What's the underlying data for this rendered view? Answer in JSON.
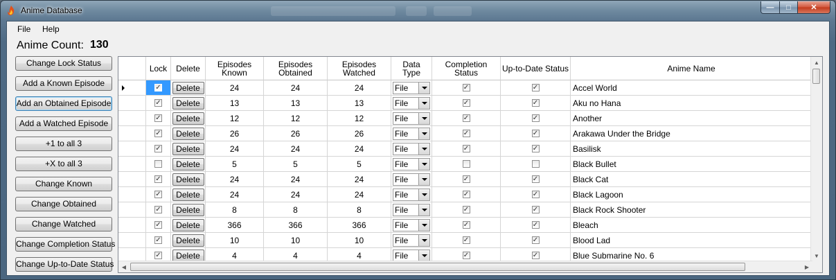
{
  "window": {
    "title": "Anime Database",
    "controls": {
      "minimize": "—",
      "maximize": "□",
      "close": "✕"
    }
  },
  "menu": [
    "File",
    "Help"
  ],
  "count": {
    "label": "Anime Count:",
    "value": "130"
  },
  "buttons": [
    "Change Lock Status",
    "Add a Known Episode",
    "Add an Obtained Episode",
    "Add a Watched Episode",
    "+1 to all 3",
    "+X to all 3",
    "Change Known",
    "Change Obtained",
    "Change Watched",
    "Change Completion Status",
    "Change Up-to-Date Status"
  ],
  "grid": {
    "columns": [
      "Lock",
      "Delete",
      "Episodes Known",
      "Episodes Obtained",
      "Episodes Watched",
      "Data Type",
      "Completion Status",
      "Up-to-Date Status",
      "Anime Name"
    ],
    "delete_label": "Delete",
    "rows": [
      {
        "lock": true,
        "known": "24",
        "obtained": "24",
        "watched": "24",
        "type": "File",
        "complete": true,
        "uptodate": true,
        "name": "Accel World"
      },
      {
        "lock": true,
        "known": "13",
        "obtained": "13",
        "watched": "13",
        "type": "File",
        "complete": true,
        "uptodate": true,
        "name": "Aku no Hana"
      },
      {
        "lock": true,
        "known": "12",
        "obtained": "12",
        "watched": "12",
        "type": "File",
        "complete": true,
        "uptodate": true,
        "name": "Another"
      },
      {
        "lock": true,
        "known": "26",
        "obtained": "26",
        "watched": "26",
        "type": "File",
        "complete": true,
        "uptodate": true,
        "name": "Arakawa Under the Bridge"
      },
      {
        "lock": true,
        "known": "24",
        "obtained": "24",
        "watched": "24",
        "type": "File",
        "complete": true,
        "uptodate": true,
        "name": "Basilisk"
      },
      {
        "lock": false,
        "known": "5",
        "obtained": "5",
        "watched": "5",
        "type": "File",
        "complete": false,
        "uptodate": false,
        "name": "Black Bullet"
      },
      {
        "lock": true,
        "known": "24",
        "obtained": "24",
        "watched": "24",
        "type": "File",
        "complete": true,
        "uptodate": true,
        "name": "Black Cat"
      },
      {
        "lock": true,
        "known": "24",
        "obtained": "24",
        "watched": "24",
        "type": "File",
        "complete": true,
        "uptodate": true,
        "name": "Black Lagoon"
      },
      {
        "lock": true,
        "known": "8",
        "obtained": "8",
        "watched": "8",
        "type": "File",
        "complete": true,
        "uptodate": true,
        "name": "Black Rock Shooter"
      },
      {
        "lock": true,
        "known": "366",
        "obtained": "366",
        "watched": "366",
        "type": "File",
        "complete": true,
        "uptodate": true,
        "name": "Bleach"
      },
      {
        "lock": true,
        "known": "10",
        "obtained": "10",
        "watched": "10",
        "type": "File",
        "complete": true,
        "uptodate": true,
        "name": "Blood Lad"
      },
      {
        "lock": true,
        "known": "4",
        "obtained": "4",
        "watched": "4",
        "type": "File",
        "complete": true,
        "uptodate": true,
        "name": "Blue Submarine No. 6"
      }
    ]
  },
  "icons": {
    "app": "flame-icon",
    "current_row": "row-pointer-icon",
    "scroll_up": "scroll-up-arrow-icon",
    "scroll_down": "scroll-down-arrow-icon",
    "scroll_left": "scroll-left-arrow-icon",
    "scroll_right": "scroll-right-arrow-icon"
  },
  "colors": {
    "selection": "#3399ff",
    "close_button": "#c23a1c",
    "chrome": "#5d7891"
  }
}
